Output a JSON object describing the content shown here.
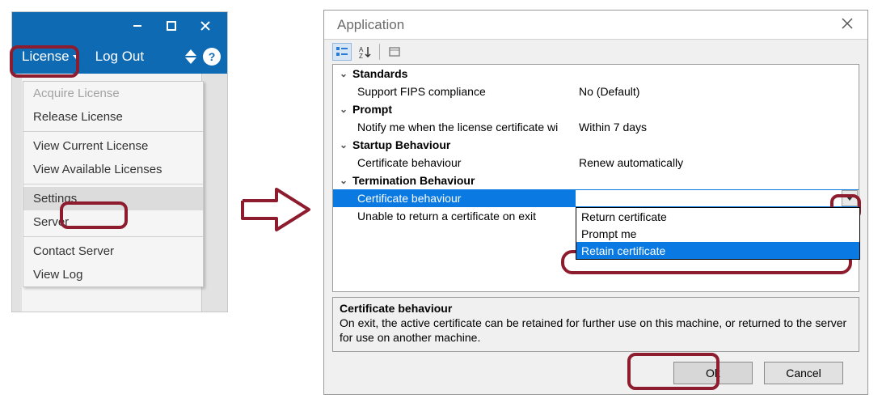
{
  "menubar": {
    "license_label": "License",
    "logout_label": "Log Out"
  },
  "menu_items": {
    "acquire": "Acquire License",
    "release": "Release License",
    "view_current": "View Current License",
    "view_available": "View Available Licenses",
    "settings": "Settings",
    "server": "Server",
    "contact_server": "Contact Server",
    "view_log": "View Log"
  },
  "dialog": {
    "title": "Application",
    "categories": {
      "standards": {
        "label": "Standards",
        "props": {
          "fips": {
            "label": "Support FIPS compliance",
            "value": "No (Default)"
          }
        }
      },
      "prompt": {
        "label": "Prompt",
        "props": {
          "notify": {
            "label": "Notify me when the license certificate wi",
            "value": "Within 7 days"
          }
        }
      },
      "startup": {
        "label": "Startup Behaviour",
        "props": {
          "cert": {
            "label": "Certificate behaviour",
            "value": "Renew automatically"
          }
        }
      },
      "termination": {
        "label": "Termination Behaviour",
        "props": {
          "cert": {
            "label": "Certificate behaviour",
            "value": ""
          },
          "unable": {
            "label": "Unable to return a certificate on exit",
            "value": ""
          }
        }
      }
    },
    "options": {
      "return": "Return certificate",
      "prompt": "Prompt me",
      "retain": "Retain certificate"
    },
    "desc": {
      "title": "Certificate behaviour",
      "body": "On exit, the active certificate can be retained for further use on this machine, or returned to the server for use on another machine."
    },
    "buttons": {
      "ok": "Ok",
      "cancel": "Cancel"
    }
  }
}
